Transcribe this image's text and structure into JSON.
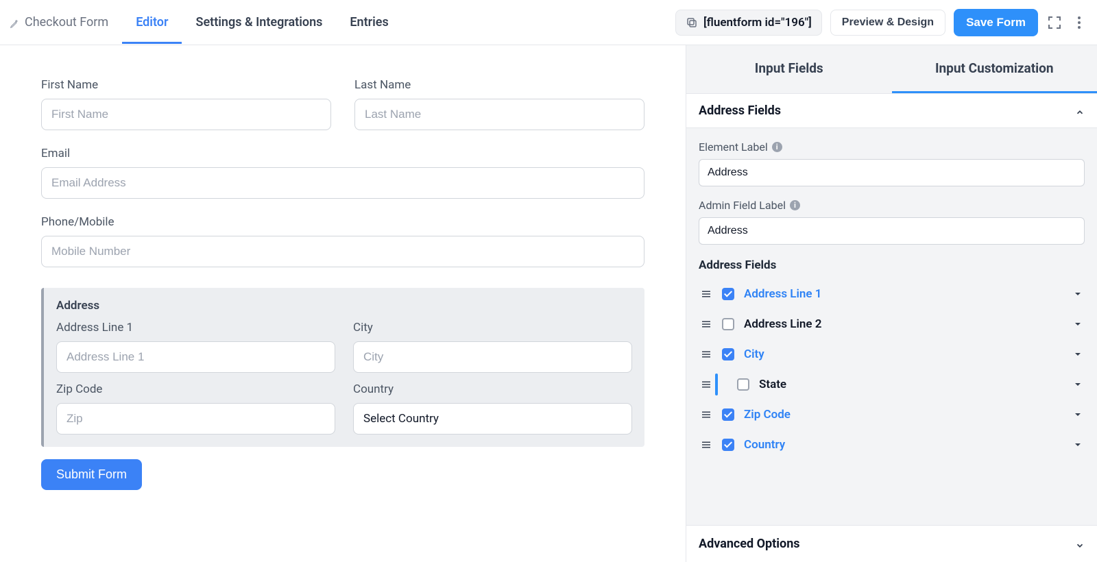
{
  "header": {
    "form_title": "Checkout Form",
    "tabs": {
      "editor": "Editor",
      "settings": "Settings & Integrations",
      "entries": "Entries"
    },
    "shortcode": "[fluentform id=\"196\"]",
    "preview_btn": "Preview & Design",
    "save_btn": "Save Form"
  },
  "form": {
    "first_name": {
      "label": "First Name",
      "placeholder": "First Name"
    },
    "last_name": {
      "label": "Last Name",
      "placeholder": "Last Name"
    },
    "email": {
      "label": "Email",
      "placeholder": "Email Address"
    },
    "phone": {
      "label": "Phone/Mobile",
      "placeholder": "Mobile Number"
    },
    "address": {
      "title": "Address",
      "line1": {
        "label": "Address Line 1",
        "placeholder": "Address Line 1"
      },
      "city": {
        "label": "City",
        "placeholder": "City"
      },
      "zip": {
        "label": "Zip Code",
        "placeholder": "Zip"
      },
      "country": {
        "label": "Country",
        "placeholder": "Select Country"
      }
    },
    "submit": "Submit Form"
  },
  "sidebar": {
    "tabs": {
      "fields": "Input Fields",
      "custom": "Input Customization"
    },
    "section_address": "Address Fields",
    "element_label": {
      "label": "Element Label",
      "value": "Address"
    },
    "admin_label": {
      "label": "Admin Field Label",
      "value": "Address"
    },
    "sub_heading": "Address Fields",
    "items": [
      {
        "label": "Address Line 1",
        "checked": true
      },
      {
        "label": "Address Line 2",
        "checked": false
      },
      {
        "label": "City",
        "checked": true
      },
      {
        "label": "State",
        "checked": false,
        "highlighted": true
      },
      {
        "label": "Zip Code",
        "checked": true
      },
      {
        "label": "Country",
        "checked": true
      }
    ],
    "advanced": "Advanced Options"
  }
}
